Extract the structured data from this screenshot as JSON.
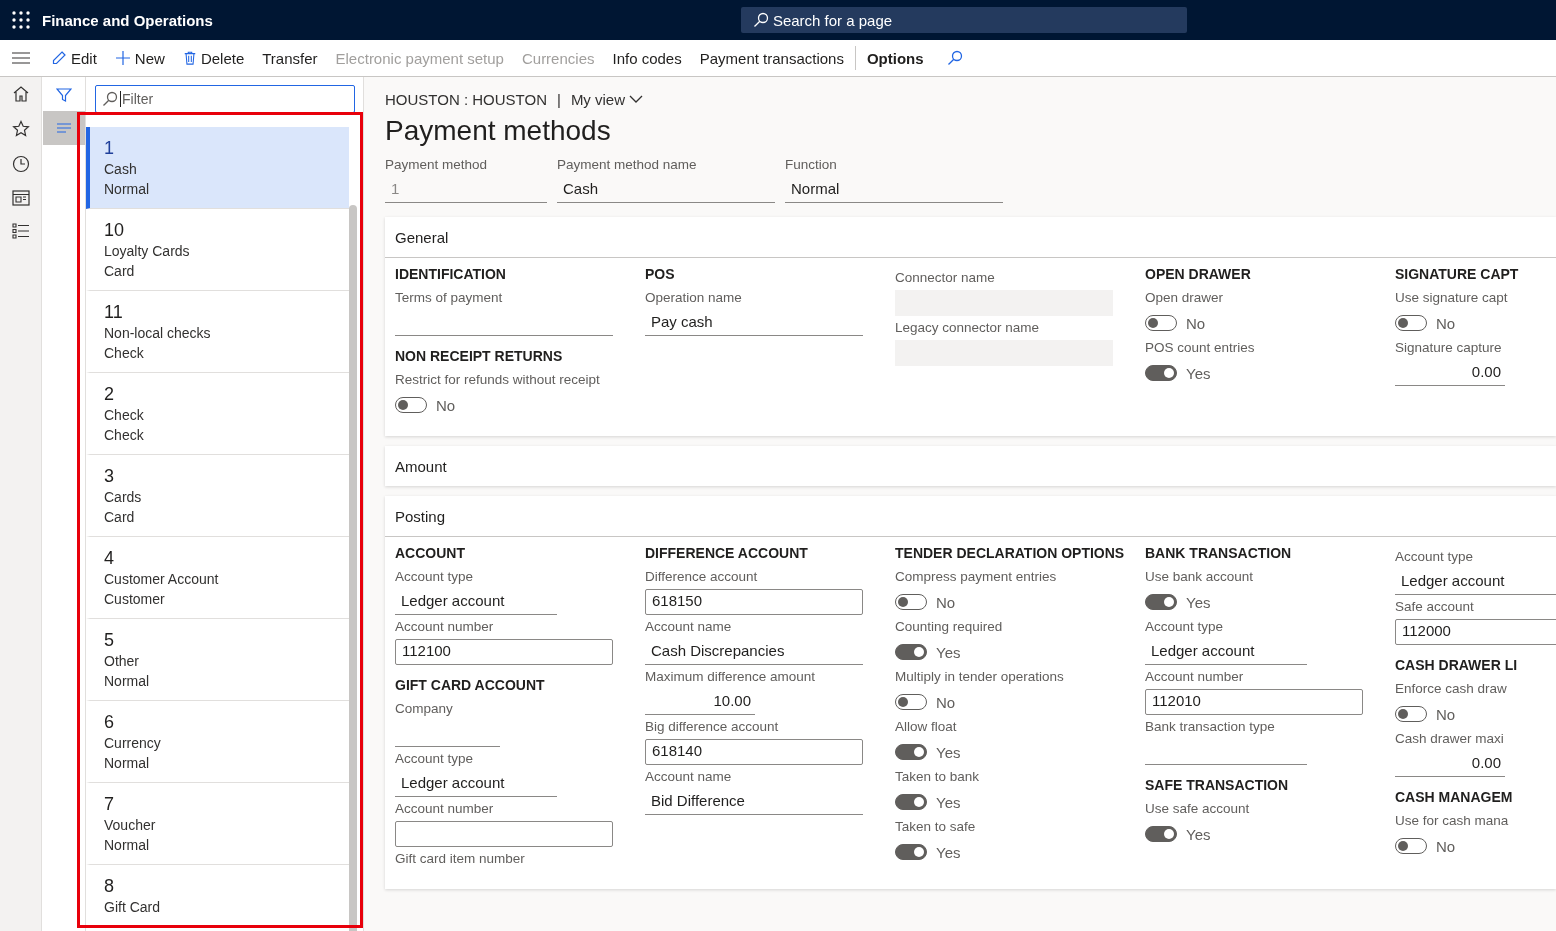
{
  "app": {
    "title": "Finance and Operations",
    "search": {
      "placeholder": "Search for a page"
    }
  },
  "toolbar": {
    "items": [
      {
        "label": "Edit",
        "disabled": false
      },
      {
        "label": "New",
        "disabled": false
      },
      {
        "label": "Delete",
        "disabled": false
      },
      {
        "label": "Transfer",
        "disabled": false
      },
      {
        "label": "Electronic payment setup",
        "disabled": true
      },
      {
        "label": "Currencies",
        "disabled": true
      },
      {
        "label": "Info codes",
        "disabled": false
      },
      {
        "label": "Payment transactions",
        "disabled": false
      }
    ],
    "options": "Options"
  },
  "list": {
    "filter": {
      "placeholder": "Filter"
    },
    "items": [
      {
        "number": "1",
        "name": "Cash",
        "function": "Normal",
        "selected": true
      },
      {
        "number": "10",
        "name": "Loyalty Cards",
        "function": "Card",
        "selected": false
      },
      {
        "number": "11",
        "name": "Non-local checks",
        "function": "Check",
        "selected": false
      },
      {
        "number": "2",
        "name": "Check",
        "function": "Check",
        "selected": false
      },
      {
        "number": "3",
        "name": "Cards",
        "function": "Card",
        "selected": false
      },
      {
        "number": "4",
        "name": "Customer Account",
        "function": "Customer",
        "selected": false
      },
      {
        "number": "5",
        "name": "Other",
        "function": "Normal",
        "selected": false
      },
      {
        "number": "6",
        "name": "Currency",
        "function": "Normal",
        "selected": false
      },
      {
        "number": "7",
        "name": "Voucher",
        "function": "Normal",
        "selected": false
      },
      {
        "number": "8",
        "name": "Gift Card",
        "selected": false
      }
    ]
  },
  "breadcrumb": {
    "company": "HOUSTON : HOUSTON",
    "separator": "|",
    "view": "My view"
  },
  "title": "Payment methods",
  "header_fields": [
    {
      "label": "Payment method",
      "value": "1",
      "kind": "key"
    },
    {
      "label": "Payment method name",
      "value": "Cash",
      "kind": "text"
    },
    {
      "label": "Function",
      "value": "Normal",
      "kind": "text"
    }
  ],
  "sections": [
    {
      "title": "General",
      "columns": [
        [
          {
            "heading": "IDENTIFICATION",
            "fields": [
              {
                "label": "Terms of payment",
                "kind": "text"
              }
            ]
          },
          {
            "heading": "NON RECEIPT RETURNS",
            "fields": [
              {
                "label": "Restrict for refunds without receipt",
                "kind": "toggle",
                "on": false,
                "value": "No"
              }
            ]
          }
        ],
        [
          {
            "heading": "POS",
            "fields": [
              {
                "label": "Operation name",
                "kind": "text",
                "value": "Pay cash"
              }
            ]
          }
        ],
        [
          {
            "fields": [
              {
                "label": "Connector name",
                "kind": "readonly"
              },
              {
                "label": "Legacy connector name",
                "kind": "readonly"
              }
            ]
          }
        ],
        [
          {
            "heading": "OPEN DRAWER",
            "fields": [
              {
                "label": "Open drawer",
                "kind": "toggle",
                "on": false,
                "value": "No"
              },
              {
                "label": "POS count entries",
                "kind": "toggle",
                "on": true,
                "value": "Yes"
              }
            ]
          }
        ],
        [
          {
            "heading": "SIGNATURE CAPT",
            "fields": [
              {
                "label": "Use signature capt",
                "kind": "toggle",
                "on": false,
                "value": "No"
              },
              {
                "label": "Signature capture",
                "kind": "amount",
                "value": "0.00"
              }
            ]
          }
        ]
      ]
    },
    {
      "title": "Amount"
    },
    {
      "title": "Posting",
      "columns": [
        [
          {
            "heading": "ACCOUNT",
            "fields": [
              {
                "label": "Account type",
                "kind": "text-short",
                "value": "Ledger account"
              },
              {
                "label": "Account number",
                "kind": "box",
                "value": "112100"
              }
            ]
          },
          {
            "heading": "GIFT CARD ACCOUNT",
            "fields": [
              {
                "label": "Company",
                "kind": "text-tiny"
              },
              {
                "label": "Account type",
                "kind": "text-short",
                "value": "Ledger account"
              },
              {
                "label": "Account number",
                "kind": "box"
              },
              {
                "label": "Gift card item number",
                "kind": "label"
              }
            ]
          }
        ],
        [
          {
            "heading": "DIFFERENCE ACCOUNT",
            "fields": [
              {
                "label": "Difference account",
                "kind": "box",
                "value": "618150"
              },
              {
                "label": "Account name",
                "kind": "text",
                "value": "Cash Discrepancies"
              },
              {
                "label": "Maximum difference amount",
                "kind": "amount",
                "value": "10.00"
              },
              {
                "label": "Big difference account",
                "kind": "box",
                "value": "618140"
              },
              {
                "label": "Account name",
                "kind": "text",
                "value": "Bid Difference"
              }
            ]
          }
        ],
        [
          {
            "heading": "TENDER DECLARATION OPTIONS",
            "fields": [
              {
                "label": "Compress payment entries",
                "kind": "toggle",
                "on": false,
                "value": "No"
              },
              {
                "label": "Counting required",
                "kind": "toggle",
                "on": true,
                "value": "Yes"
              },
              {
                "label": "Multiply in tender operations",
                "kind": "toggle",
                "on": false,
                "value": "No"
              },
              {
                "label": "Allow float",
                "kind": "toggle",
                "on": true,
                "value": "Yes"
              },
              {
                "label": "Taken to bank",
                "kind": "toggle",
                "on": true,
                "value": "Yes"
              },
              {
                "label": "Taken to safe",
                "kind": "toggle",
                "on": true,
                "value": "Yes"
              }
            ]
          }
        ],
        [
          {
            "heading": "BANK TRANSACTION",
            "fields": [
              {
                "label": "Use bank account",
                "kind": "toggle",
                "on": true,
                "value": "Yes"
              },
              {
                "label": "Account type",
                "kind": "text-short",
                "value": "Ledger account"
              },
              {
                "label": "Account number",
                "kind": "box",
                "value": "112010"
              },
              {
                "label": "Bank transaction type",
                "kind": "text-short"
              }
            ]
          },
          {
            "heading": "SAFE TRANSACTION",
            "fields": [
              {
                "label": "Use safe account",
                "kind": "toggle",
                "on": true,
                "value": "Yes"
              }
            ]
          }
        ],
        [
          {
            "fields": [
              {
                "label": "Account type",
                "kind": "text-short",
                "value": "Ledger account"
              },
              {
                "label": "Safe account",
                "kind": "box",
                "value": "112000"
              }
            ]
          },
          {
            "heading": "CASH DRAWER LI",
            "fields": [
              {
                "label": "Enforce cash draw",
                "kind": "toggle",
                "on": false,
                "value": "No"
              },
              {
                "label": "Cash drawer maxi",
                "kind": "amount",
                "value": "0.00"
              }
            ]
          },
          {
            "heading": "CASH MANAGEM",
            "fields": [
              {
                "label": "Use for cash mana",
                "kind": "toggle",
                "on": false,
                "value": "No"
              }
            ]
          }
        ]
      ]
    }
  ]
}
